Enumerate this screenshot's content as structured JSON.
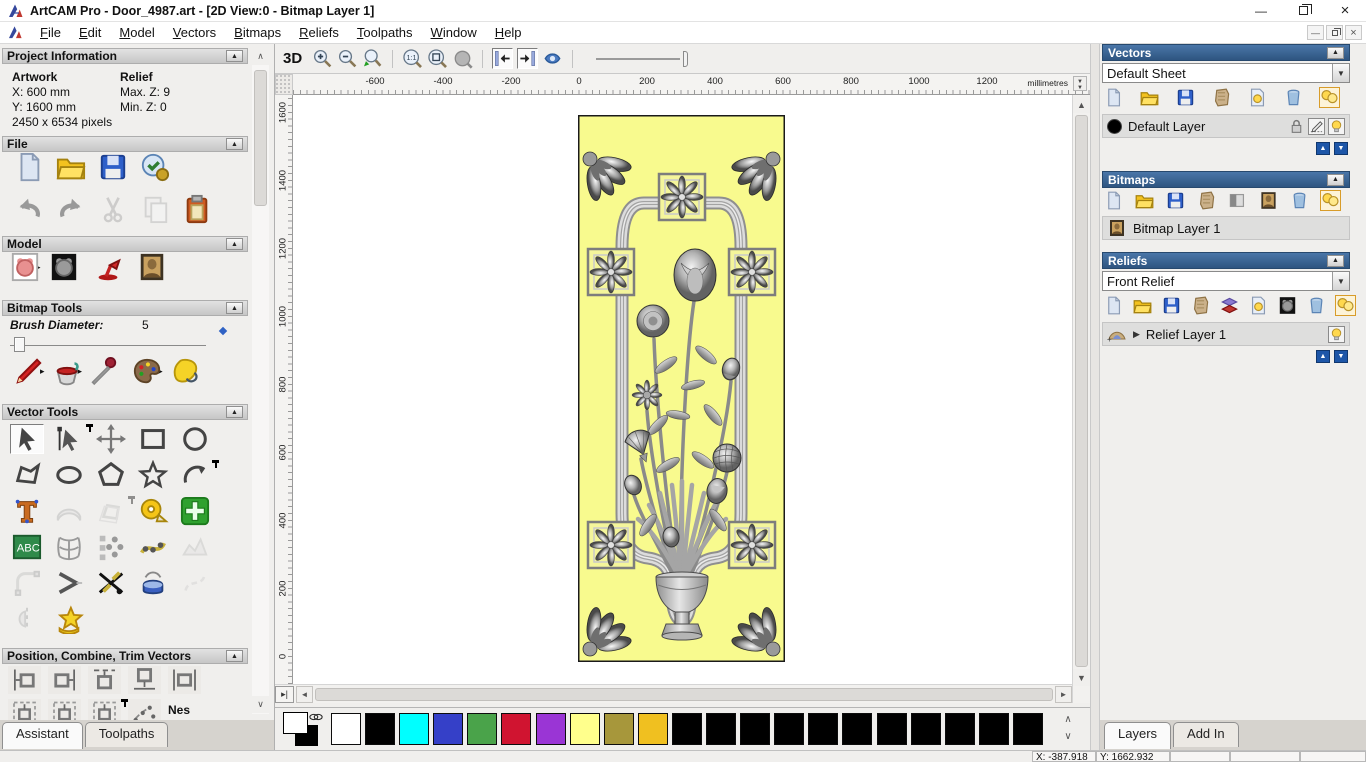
{
  "window": {
    "title": "ArtCAM Pro - Door_4987.art - [2D View:0 - Bitmap Layer 1]"
  },
  "menu": {
    "items": [
      "File",
      "Edit",
      "Model",
      "Vectors",
      "Bitmaps",
      "Reliefs",
      "Toolpaths",
      "Window",
      "Help"
    ]
  },
  "assistant": {
    "project_info": {
      "header": "Project Information",
      "artwork_label": "Artwork",
      "relief_label": "Relief",
      "x": "X: 600 mm",
      "y": "Y: 1600 mm",
      "pixels": "2450 x 6534 pixels",
      "max_z": "Max. Z: 9",
      "min_z": "Min. Z: 0"
    },
    "file": {
      "header": "File",
      "row1": [
        {
          "name": "new-model-icon",
          "t": "page"
        },
        {
          "name": "open-file-icon",
          "t": "folder"
        },
        {
          "name": "save-file-icon",
          "t": "floppy"
        },
        {
          "name": "model-properties-icon",
          "t": "shield"
        }
      ],
      "row2": [
        {
          "name": "undo-icon",
          "t": "undo"
        },
        {
          "name": "redo-icon",
          "t": "redo"
        },
        {
          "name": "cut-icon",
          "t": "cut",
          "disabled": true
        },
        {
          "name": "copy-icon",
          "t": "copy",
          "disabled": true
        },
        {
          "name": "paste-icon",
          "t": "clip"
        }
      ]
    },
    "model": {
      "header": "Model",
      "row": [
        {
          "name": "set-model-size-icon",
          "t": "teddy",
          "arrow": true
        },
        {
          "name": "adjust-model-icon",
          "t": "teddyd"
        },
        {
          "name": "lighting-icon",
          "t": "lamp"
        },
        {
          "name": "load-bitmap-icon",
          "t": "mona"
        }
      ]
    },
    "bitmap_tools": {
      "header": "Bitmap Tools",
      "brush_label": "Brush Diameter:",
      "brush_value": "5",
      "row": [
        {
          "name": "paint-brush-icon",
          "t": "pen",
          "arrow": true
        },
        {
          "name": "flood-fill-icon",
          "t": "bucket",
          "arrow": true
        },
        {
          "name": "colour-picker-icon",
          "t": "dropper"
        },
        {
          "name": "palette-icon",
          "t": "palette2",
          "arrow": true
        },
        {
          "name": "reduce-colours-icon",
          "t": "flood"
        }
      ]
    },
    "vector_tools": {
      "header": "Vector Tools",
      "items": [
        {
          "name": "select-vectors-tool",
          "t": "cursor",
          "pressed": true
        },
        {
          "name": "node-editing-tool",
          "t": "cursornode",
          "pin": true
        },
        {
          "name": "transform-vectors-tool",
          "t": "transform"
        },
        {
          "name": "create-rectangle-tool",
          "t": "rect"
        },
        {
          "name": "create-circle-tool",
          "t": "circ"
        },
        {
          "name": "create-polyline-tool",
          "t": "polyline"
        },
        {
          "name": "create-ellipse-tool",
          "t": "ell"
        },
        {
          "name": "create-polygon-tool",
          "t": "pent"
        },
        {
          "name": "create-star-tool",
          "t": "star"
        },
        {
          "name": "create-arc-tool",
          "t": "arc",
          "pin": true
        },
        {
          "name": "create-text-tool",
          "t": "textT"
        },
        {
          "name": "wrap-text-tool",
          "t": "wrap",
          "disabled": true
        },
        {
          "name": "offset-vector-tool",
          "t": "offset",
          "disabled": true,
          "pin": true
        },
        {
          "name": "measure-tool",
          "t": "tape"
        },
        {
          "name": "paste-vector-tool",
          "t": "gcross"
        },
        {
          "name": "text-block-tool",
          "t": "abc"
        },
        {
          "name": "distort-vectors-tool",
          "t": "distort"
        },
        {
          "name": "block-copy-tool",
          "t": "blockcopy"
        },
        {
          "name": "paste-along-curve-tool",
          "t": "pastecurve"
        },
        {
          "name": "vector-doctor-tool",
          "t": "doctor",
          "disabled": true
        },
        {
          "name": "fillet-tool",
          "t": "fillet",
          "disabled": true
        },
        {
          "name": "bisector-tool",
          "t": "bisector"
        },
        {
          "name": "trim-vectors-tool",
          "t": "trim"
        },
        {
          "name": "extrude-vectors-tool",
          "t": "extrude"
        },
        {
          "name": "free-form-tool",
          "t": "freeform",
          "disabled": true
        },
        {
          "name": "mirror-vectors-tool",
          "t": "mirror",
          "disabled": true
        },
        {
          "name": "vector-library-tool",
          "t": "libstar"
        }
      ]
    },
    "position_tools": {
      "header": "Position, Combine, Trim Vectors",
      "row1": [
        {
          "name": "align-left-button",
          "t": "posl"
        },
        {
          "name": "align-right-button",
          "t": "posr"
        },
        {
          "name": "align-top-button",
          "t": "post"
        },
        {
          "name": "align-bottom-button",
          "t": "posb"
        },
        {
          "name": "center-horizontally-button",
          "t": "posc"
        }
      ],
      "row2": [
        {
          "name": "center-in-page-button",
          "t": "posin"
        },
        {
          "name": "center-both-button",
          "t": "posin"
        },
        {
          "name": "align-centers-button",
          "t": "posin",
          "pin": true
        },
        {
          "name": "block-scatter-button",
          "t": "scatter"
        },
        {
          "name": "nesting-button",
          "t": "nes",
          "label": "Nes"
        }
      ]
    },
    "tabs": [
      {
        "label": "Assistant",
        "active": true
      },
      {
        "label": "Toolpaths",
        "active": false
      }
    ]
  },
  "view": {
    "toolbar": {
      "items": [
        {
          "name": "view-3d-button",
          "t": "label",
          "label": "3D"
        },
        {
          "name": "zoom-in-button",
          "t": "zin"
        },
        {
          "name": "zoom-out-button",
          "t": "zout"
        },
        {
          "name": "zoom-previous-button",
          "t": "zlast"
        },
        {
          "name": "separator",
          "t": "sep"
        },
        {
          "name": "zoom-1to1-button",
          "t": "z11"
        },
        {
          "name": "zoom-fit-button",
          "t": "zfit"
        },
        {
          "name": "zoom-objects-button",
          "t": "zobj"
        },
        {
          "name": "separator",
          "t": "sep"
        },
        {
          "name": "snap-left-toggle",
          "t": "tgl",
          "pressed": true
        },
        {
          "name": "snap-right-toggle",
          "t": "tgr",
          "pressed": true
        },
        {
          "name": "pan-view-button",
          "t": "pan"
        },
        {
          "name": "separator",
          "t": "sep"
        },
        {
          "name": "contrast-slider",
          "t": "slider"
        }
      ]
    },
    "ruler_h": {
      "ticks": [
        "-600",
        "-400",
        "-200",
        "0",
        "200",
        "400",
        "600",
        "800",
        "1000",
        "1200"
      ],
      "units": "millimetres"
    },
    "ruler_v": {
      "ticks": [
        "1600",
        "1400",
        "1200",
        "1000",
        "800",
        "600",
        "400",
        "200",
        "0"
      ]
    },
    "door_color": "#f8fa8e"
  },
  "vectors_panel": {
    "header": "Vectors",
    "sheet": "Default Sheet",
    "tools": [
      {
        "name": "new-sheet-icon",
        "t": "page"
      },
      {
        "name": "open-vectors-icon",
        "t": "folder"
      },
      {
        "name": "save-vectors-icon",
        "t": "floppy"
      },
      {
        "name": "import-vectors-icon",
        "t": "crumple"
      },
      {
        "name": "toggle-visibility-icon",
        "t": "bulbpage"
      },
      {
        "name": "delete-layer-icon",
        "t": "trash"
      },
      {
        "name": "all-layers-visible-icon",
        "t": "bulbs",
        "active": true
      }
    ],
    "layer": {
      "label": "Default Layer",
      "controls": [
        {
          "name": "lock-layer-icon",
          "t": "lock"
        },
        {
          "name": "edit-layer-icon",
          "t": "pencil",
          "pressed": true
        },
        {
          "name": "layer-visibility-icon",
          "t": "bulb",
          "pressed": true
        }
      ]
    }
  },
  "bitmaps_panel": {
    "header": "Bitmaps",
    "tools": [
      {
        "name": "new-bitmap-layer-icon",
        "t": "page"
      },
      {
        "name": "open-bitmap-icon",
        "t": "folder"
      },
      {
        "name": "save-bitmap-icon",
        "t": "floppy"
      },
      {
        "name": "import-bitmap-icon",
        "t": "crumple"
      },
      {
        "name": "greyscale-icon",
        "t": "grad"
      },
      {
        "name": "bitmap-to-layer-icon",
        "t": "mona"
      },
      {
        "name": "delete-bitmap-layer-icon",
        "t": "trash"
      },
      {
        "name": "all-bitmap-layers-visible-icon",
        "t": "bulbs",
        "active": true
      }
    ],
    "layer": {
      "label": "Bitmap Layer 1"
    }
  },
  "reliefs_panel": {
    "header": "Reliefs",
    "relief": "Front Relief",
    "tools": [
      {
        "name": "new-relief-layer-icon",
        "t": "page"
      },
      {
        "name": "open-relief-icon",
        "t": "folder"
      },
      {
        "name": "save-relief-icon",
        "t": "floppy"
      },
      {
        "name": "import-relief-icon",
        "t": "crumple"
      },
      {
        "name": "combine-relief-icon",
        "t": "stack"
      },
      {
        "name": "toggle-relief-visibility-icon",
        "t": "bulbpage"
      },
      {
        "name": "greyscale-from-relief-icon",
        "t": "teddyd"
      },
      {
        "name": "delete-relief-layer-icon",
        "t": "trash"
      },
      {
        "name": "all-relief-layers-visible-icon",
        "t": "bulbs",
        "active": true
      }
    ],
    "layer": {
      "label": "Relief Layer 1",
      "controls": [
        {
          "name": "relief-layer-visibility-icon",
          "t": "bulb",
          "pressed": true
        }
      ]
    }
  },
  "right_tabs": [
    {
      "label": "Layers",
      "active": true
    },
    {
      "label": "Add In",
      "active": false
    }
  ],
  "palette": {
    "colors": [
      "#ffffff",
      "#000000",
      "#00ffff",
      "#3540c8",
      "#4aa34a",
      "#d01430",
      "#9a35d5",
      "#ffff8c",
      "#a7973b",
      "#f0c020",
      "#000000",
      "#000000",
      "#000000",
      "#000000",
      "#000000",
      "#000000",
      "#000000",
      "#000000",
      "#000000",
      "#000000",
      "#000000"
    ]
  },
  "status": {
    "cells": [
      "X: -387.918",
      "Y: 1662.932",
      "",
      "",
      ""
    ]
  }
}
